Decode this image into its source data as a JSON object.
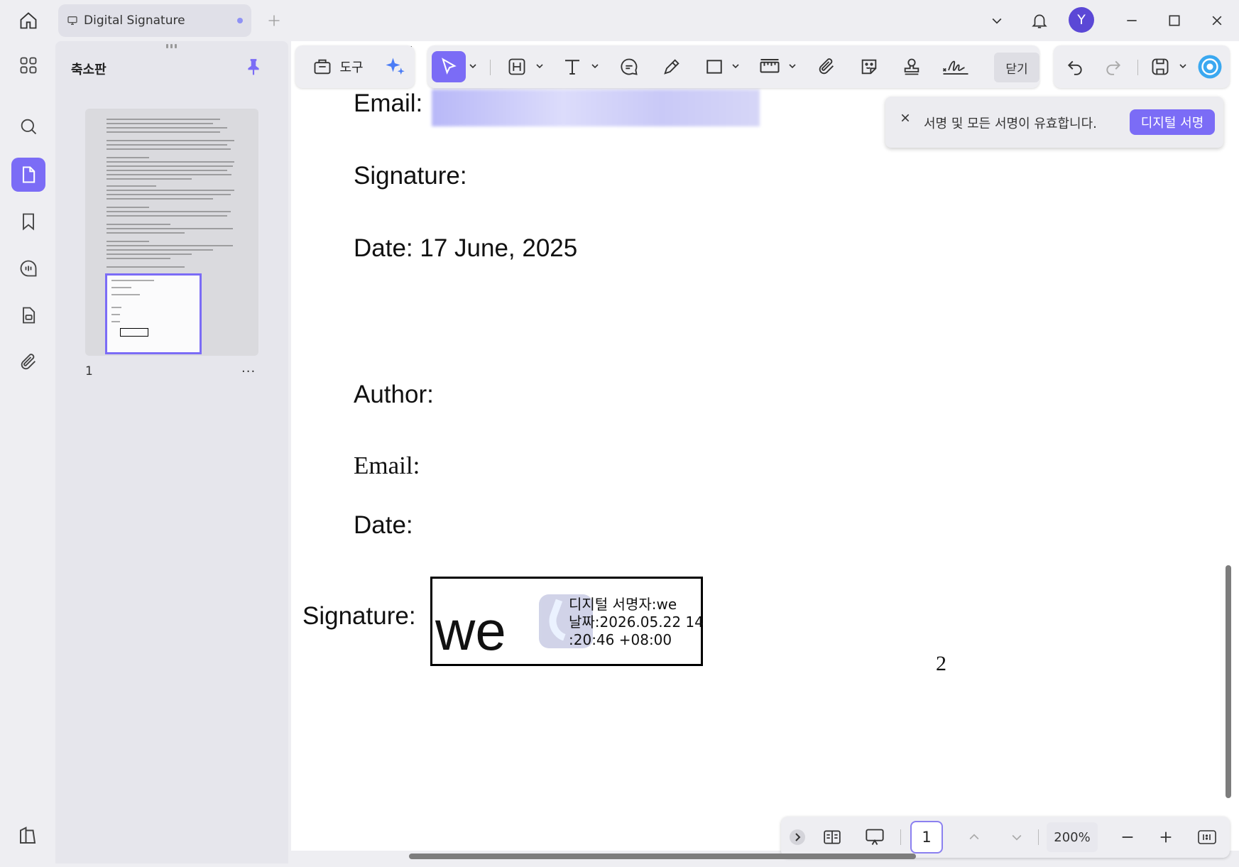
{
  "titlebar": {
    "tab_title": "Digital Signature",
    "avatar_initial": "Y"
  },
  "thumbnails": {
    "title": "축소판",
    "page_number": "1",
    "more": "···"
  },
  "toolbar": {
    "tools_label": "도구",
    "close_label": "닫기"
  },
  "notice": {
    "message": "서명 및 모든 서명이 유효합니다.",
    "button": "디지털 서명"
  },
  "document": {
    "email_label_1": "Email:",
    "signature_label_1": "Signature:",
    "date_line": "Date: 17 June, 2025",
    "author_label": "Author:",
    "email_label_2": "Email:",
    "date_label_2": "Date:",
    "signature_label_2": "Signature:",
    "signature_name": "we",
    "signature_info": "디지털 서명자:we\n날짜:2026.05.22 14\n:20:46 +08:00",
    "page_number": "2"
  },
  "navbar": {
    "current_page": "1",
    "zoom": "200%"
  },
  "colors": {
    "accent": "#7b6cf6",
    "avatar": "#5b48d6"
  }
}
